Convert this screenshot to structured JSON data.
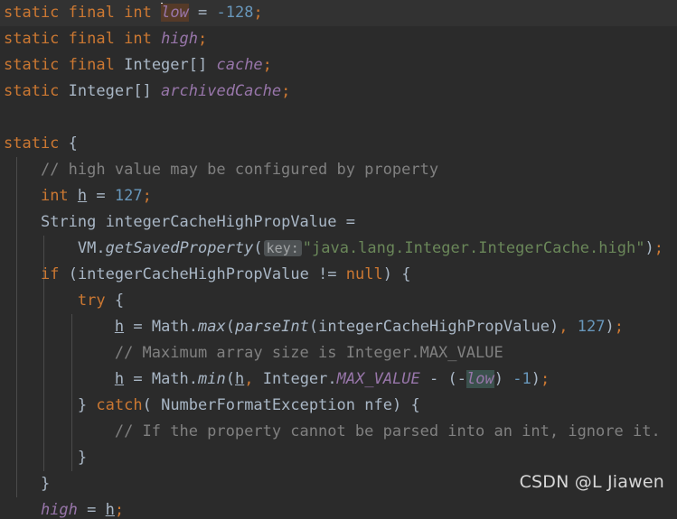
{
  "editor": {
    "language": "java",
    "theme": "darcula",
    "background_color": "#2b2b2b",
    "caret_line_color": "#323232",
    "colors": {
      "keyword": "#cc7832",
      "identifier": "#a9b7c6",
      "static_field": "#9876aa",
      "string": "#6a8759",
      "number": "#6897bb",
      "comment": "#808080",
      "write_highlight": "#553a28",
      "read_highlight": "#3b514d",
      "inlay_hint_bg": "#4e5254",
      "indent_guide": "#4b4b4b",
      "caret": "#e6e6e6"
    }
  },
  "code": {
    "line1": {
      "kw_static": "static",
      "kw_final": "final",
      "kw_int": "int",
      "name": "low",
      "eq": "=",
      "value": "-128",
      "semi": ";"
    },
    "line2": {
      "kw_static": "static",
      "kw_final": "final",
      "kw_int": "int",
      "name": "high",
      "semi": ";"
    },
    "line3": {
      "kw_static": "static",
      "kw_final": "final",
      "type": "Integer[]",
      "name": "cache",
      "semi": ";"
    },
    "line4": {
      "kw_static": "static",
      "type": "Integer[]",
      "name": "archivedCache",
      "semi": ";"
    },
    "line6": {
      "kw_static": "static",
      "brace": "{"
    },
    "line7": {
      "comment": "// high value may be configured by property"
    },
    "line8": {
      "kw_int": "int",
      "name": "h",
      "eq": "=",
      "value": "127",
      "semi": ";"
    },
    "line9": {
      "type": "String",
      "name": "integerCacheHighPropValue",
      "eq": "="
    },
    "line10": {
      "receiver": "VM",
      "dot": ".",
      "method": "getSavedProperty",
      "open": "(",
      "hint": "key:",
      "string": "\"java.lang.Integer.IntegerCache.high\"",
      "close": ")",
      "semi": ";"
    },
    "line11": {
      "kw_if": "if",
      "open": "(",
      "name": "integerCacheHighPropValue",
      "op": "!=",
      "kw_null": "null",
      "close": ")",
      "brace": "{"
    },
    "line12": {
      "kw_try": "try",
      "brace": "{"
    },
    "line13": {
      "name": "h",
      "eq": "=",
      "receiver": "Math",
      "dot": ".",
      "method": "max",
      "open": "(",
      "inner_method": "parseInt",
      "inner_open": "(",
      "arg": "integerCacheHighPropValue",
      "inner_close": ")",
      "comma": ",",
      "value": "127",
      "close": ")",
      "semi": ";"
    },
    "line14": {
      "comment": "// Maximum array size is Integer.MAX_VALUE"
    },
    "line15": {
      "name": "h",
      "eq": "=",
      "receiver": "Math",
      "dot": ".",
      "method": "min",
      "open": "(",
      "arg1": "h",
      "comma": ",",
      "type": "Integer",
      "dot2": ".",
      "constant": "MAX_VALUE",
      "minus": "-",
      "paren_open": "(",
      "neg": "-",
      "low": "low",
      "paren_close": ")",
      "minus_one": "-1",
      "close": ")",
      "semi": ";"
    },
    "line16": {
      "brace_close": "}",
      "kw_catch": "catch",
      "open": "(",
      "exception_type": "NumberFormatException",
      "param": "nfe",
      "close": ")",
      "brace": "{"
    },
    "line17": {
      "comment": "// If the property cannot be parsed into an int, ignore it."
    },
    "line18": {
      "brace_close": "}"
    },
    "line19": {
      "brace_close": "}"
    },
    "line20": {
      "name": "high",
      "eq": "=",
      "value": "h",
      "semi": ";"
    }
  },
  "watermark": {
    "text": "CSDN @L Jiawen"
  }
}
